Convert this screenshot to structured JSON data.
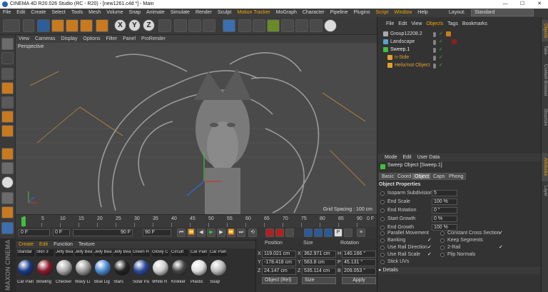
{
  "window": {
    "title": "CINEMA 4D R20.026 Studio (RC - R20) - [new1261.c4d *] - Main",
    "minimize": "—",
    "maximize": "☐",
    "close": "✕"
  },
  "menubar": {
    "items": [
      "File",
      "Edit",
      "Create",
      "Select",
      "Tools",
      "Mesh",
      "Volume",
      "Snap",
      "Animate",
      "Simulate",
      "Render",
      "Sculpt",
      "Motion Tracker",
      "MoGraph",
      "Character",
      "Pipeline",
      "Plugins",
      "Script",
      "Window",
      "Help"
    ],
    "layout_label": "Layout:",
    "layout_value": "Standard"
  },
  "viewport": {
    "menu": [
      "View",
      "Cameras",
      "Display",
      "Options",
      "Filter",
      "Panel",
      "ProRender"
    ],
    "camera": "Perspective",
    "grid_spacing": "Grid Spacing : 100 cm"
  },
  "timeline": {
    "ticks": [
      "0",
      "5",
      "10",
      "15",
      "20",
      "25",
      "30",
      "35",
      "40",
      "45",
      "50",
      "55",
      "60",
      "65",
      "70",
      "75",
      "80",
      "85",
      "90"
    ],
    "playhead_frame": "0",
    "end_tick": "0 F"
  },
  "transport": {
    "current_frame": "0 F",
    "start_frame": "0 F",
    "end_frame": "90 F",
    "max_frame": "90 F"
  },
  "materials": {
    "menu": [
      "Create",
      "Edit",
      "Function",
      "Texture"
    ],
    "items": [
      {
        "top": "Standar",
        "bottom": "Car Pain",
        "color": "#1a3a8a"
      },
      {
        "top": "Skin 3",
        "bottom": "Bowling",
        "color": "#8a1a2a"
      },
      {
        "top": "Jelly Bea",
        "bottom": "Checker",
        "color": "#aaaaaa"
      },
      {
        "top": "Jelly Bea",
        "bottom": "Wavy Li",
        "color": "#9a9a9a"
      },
      {
        "top": "Jelly Bea",
        "bottom": "Blue Lig",
        "color": "#4a8ad0"
      },
      {
        "top": "Jelly Bea",
        "bottom": "Stars",
        "color": "#222222"
      },
      {
        "top": "Green H",
        "bottom": "Solar Pa",
        "color": "#2a4a9a"
      },
      {
        "top": "Glowy C",
        "bottom": "White R",
        "color": "#cccccc"
      },
      {
        "top": "Circuit",
        "bottom": "Knikker",
        "color": "#444444"
      },
      {
        "top": "Car Pain",
        "bottom": "Plastic",
        "color": "#dddddd"
      },
      {
        "top": "Car Pain",
        "bottom": "Soap",
        "color": "#bbbbbb"
      }
    ]
  },
  "coordinates": {
    "headers": [
      "Position",
      "Size",
      "Rotation"
    ],
    "rows": [
      {
        "axis": "X",
        "pos": "119.021 cm",
        "size_axis": "X",
        "size": "362.971 cm",
        "rot_axis": "H",
        "rot": "140.166 °"
      },
      {
        "axis": "Y",
        "pos": "-178.418 cm",
        "size_axis": "Y",
        "size": "563.8 cm",
        "rot_axis": "P",
        "rot": "45.131 °"
      },
      {
        "axis": "Z",
        "pos": "24.147 cm",
        "size_axis": "Z",
        "size": "535.114 cm",
        "rot_axis": "B",
        "rot": "209.053 °"
      }
    ],
    "mode_dropdown": "Object (Rel)",
    "size_dropdown": "Size",
    "apply": "Apply"
  },
  "objects": {
    "menu": [
      "File",
      "Edit",
      "View",
      "Objects",
      "Tags",
      "Bookmarks"
    ],
    "tree": [
      {
        "name": "Group12208.2",
        "indent": 0,
        "color": "#dddddd",
        "icon": "#aaaaaa"
      },
      {
        "name": "Landscape",
        "indent": 0,
        "color": "#dddddd",
        "icon": "#5aa0d0"
      },
      {
        "name": "Sweep.1",
        "indent": 0,
        "color": "#f0f0f0",
        "icon": "#3fbf3f"
      },
      {
        "name": "n-Side",
        "indent": 1,
        "color": "#e0a030",
        "icon": "#e0a030"
      },
      {
        "name": "Helix/not Object",
        "indent": 1,
        "color": "#e0a030",
        "icon": "#e0a030"
      }
    ]
  },
  "attributes": {
    "menu": [
      "Mode",
      "Edit",
      "User Data"
    ],
    "object_title": "Sweep Object [Sweep.1]",
    "tabs": [
      "Basic",
      "Coord",
      "Object",
      "Caps",
      "Phong"
    ],
    "active_tab": "Object",
    "section": "Object Properties",
    "fields": [
      {
        "label": "Isoparm Subdivision",
        "value": "5"
      },
      {
        "label": "End Scale",
        "value": "100 %"
      },
      {
        "label": "End Rotation",
        "value": "0 °"
      },
      {
        "label": "Start Growth",
        "value": "0 %"
      },
      {
        "label": "End Growth",
        "value": "100 %"
      }
    ],
    "checks_left": [
      {
        "label": "Parallel Movement",
        "checked": ""
      },
      {
        "label": "Banking",
        "checked": "✓"
      },
      {
        "label": "Use Rail Direction",
        "checked": "✓"
      },
      {
        "label": "Use Rail Scale",
        "checked": "✓"
      },
      {
        "label": "Stick UVs",
        "checked": ""
      }
    ],
    "checks_right": [
      {
        "label": "Constant Cross Section",
        "checked": "✓"
      },
      {
        "label": "Keep Segments",
        "checked": ""
      },
      {
        "label": "2-Rail",
        "checked": "✓"
      },
      {
        "label": "Flip Normals",
        "checked": ""
      }
    ],
    "details": "Details"
  },
  "side_tabs": [
    "Objects",
    "Take",
    "Content Browser",
    "Structure",
    "Attributes",
    "Layer"
  ]
}
